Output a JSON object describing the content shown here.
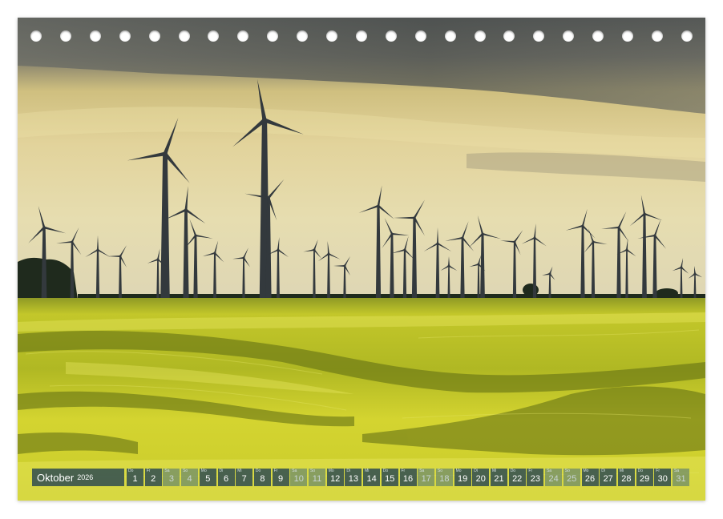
{
  "calendar": {
    "month": "Oktober",
    "year": "2026",
    "days": [
      {
        "num": "1",
        "dow": "Do",
        "weekend": false
      },
      {
        "num": "2",
        "dow": "Fr",
        "weekend": false
      },
      {
        "num": "3",
        "dow": "Sa",
        "weekend": true
      },
      {
        "num": "4",
        "dow": "So",
        "weekend": true
      },
      {
        "num": "5",
        "dow": "Mo",
        "weekend": false
      },
      {
        "num": "6",
        "dow": "Di",
        "weekend": false
      },
      {
        "num": "7",
        "dow": "Mi",
        "weekend": false
      },
      {
        "num": "8",
        "dow": "Do",
        "weekend": false
      },
      {
        "num": "9",
        "dow": "Fr",
        "weekend": false
      },
      {
        "num": "10",
        "dow": "Sa",
        "weekend": true
      },
      {
        "num": "11",
        "dow": "So",
        "weekend": true
      },
      {
        "num": "12",
        "dow": "Mo",
        "weekend": false
      },
      {
        "num": "13",
        "dow": "Di",
        "weekend": false
      },
      {
        "num": "14",
        "dow": "Mi",
        "weekend": false
      },
      {
        "num": "15",
        "dow": "Do",
        "weekend": false
      },
      {
        "num": "16",
        "dow": "Fr",
        "weekend": false
      },
      {
        "num": "17",
        "dow": "Sa",
        "weekend": true
      },
      {
        "num": "18",
        "dow": "So",
        "weekend": true
      },
      {
        "num": "19",
        "dow": "Mo",
        "weekend": false
      },
      {
        "num": "20",
        "dow": "Di",
        "weekend": false
      },
      {
        "num": "21",
        "dow": "Mi",
        "weekend": false
      },
      {
        "num": "22",
        "dow": "Do",
        "weekend": false
      },
      {
        "num": "23",
        "dow": "Fr",
        "weekend": false
      },
      {
        "num": "24",
        "dow": "Sa",
        "weekend": true
      },
      {
        "num": "25",
        "dow": "So",
        "weekend": true
      },
      {
        "num": "26",
        "dow": "Mo",
        "weekend": false
      },
      {
        "num": "27",
        "dow": "Di",
        "weekend": false
      },
      {
        "num": "28",
        "dow": "Mi",
        "weekend": false
      },
      {
        "num": "29",
        "dow": "Do",
        "weekend": false
      },
      {
        "num": "30",
        "dow": "Fr",
        "weekend": false
      },
      {
        "num": "31",
        "dow": "Sa",
        "weekend": true
      }
    ]
  },
  "binding": {
    "hole_count": 23
  },
  "photo": {
    "subject": "wind-farm",
    "colors": {
      "sky_top": "#5a5c58",
      "sky_mid": "#d8c889",
      "sky_low": "#e4d9a8",
      "field_light": "#d9d635",
      "field_dark": "#4f5a10",
      "turbine": "#33393d"
    }
  }
}
